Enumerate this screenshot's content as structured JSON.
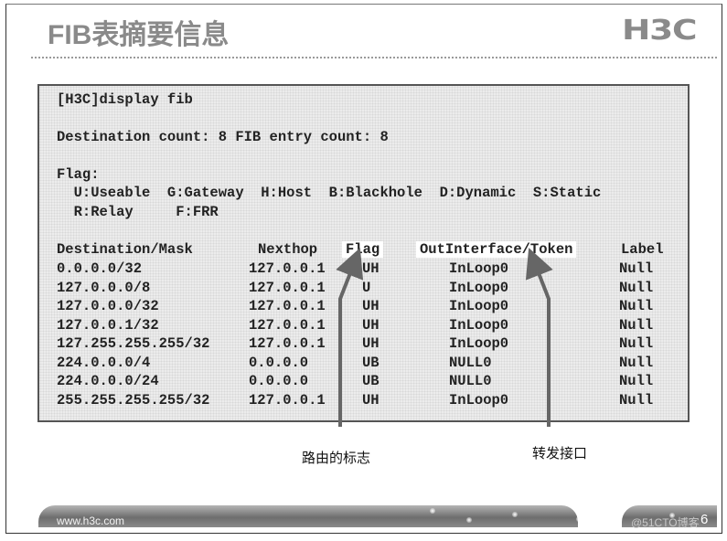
{
  "slide": {
    "title": "FIB表摘要信息",
    "logo": "H3C",
    "footer_url": "www.h3c.com",
    "page_number": "6",
    "watermark": "@51CTO博客"
  },
  "terminal": {
    "command": "[H3C]display fib",
    "summary": "Destination count: 8 FIB entry count: 8",
    "flag_heading": "Flag:",
    "flag_line1": "  U:Useable  G:Gateway  H:Host  B:Blackhole  D:Dynamic  S:Static",
    "flag_line2": "  R:Relay     F:FRR",
    "headers": {
      "destination": "Destination/Mask",
      "nexthop": "Nexthop",
      "flag": "Flag",
      "outinterface": "OutInterface/Token",
      "label": "Label"
    },
    "rows": [
      {
        "destination": "0.0.0.0/32",
        "nexthop": "127.0.0.1",
        "flag": "UH",
        "outinterface": "InLoop0",
        "label": "Null"
      },
      {
        "destination": "127.0.0.0/8",
        "nexthop": "127.0.0.1",
        "flag": "U",
        "outinterface": "InLoop0",
        "label": "Null"
      },
      {
        "destination": "127.0.0.0/32",
        "nexthop": "127.0.0.1",
        "flag": "UH",
        "outinterface": "InLoop0",
        "label": "Null"
      },
      {
        "destination": "127.0.0.1/32",
        "nexthop": "127.0.0.1",
        "flag": "UH",
        "outinterface": "InLoop0",
        "label": "Null"
      },
      {
        "destination": "127.255.255.255/32",
        "nexthop": "127.0.0.1",
        "flag": "UH",
        "outinterface": "InLoop0",
        "label": "Null"
      },
      {
        "destination": "224.0.0.0/4",
        "nexthop": "0.0.0.0",
        "flag": "UB",
        "outinterface": "NULL0",
        "label": "Null"
      },
      {
        "destination": "224.0.0.0/24",
        "nexthop": "0.0.0.0",
        "flag": "UB",
        "outinterface": "NULL0",
        "label": "Null"
      },
      {
        "destination": "255.255.255.255/32",
        "nexthop": "127.0.0.1",
        "flag": "UH",
        "outinterface": "InLoop0",
        "label": "Null"
      }
    ]
  },
  "annotations": {
    "flag_caption": "路由的标志",
    "interface_caption": "转发接口"
  },
  "colors": {
    "title_gray": "#8a8a8a",
    "arrow_gray": "#666666",
    "terminal_bg": "#ececec"
  }
}
